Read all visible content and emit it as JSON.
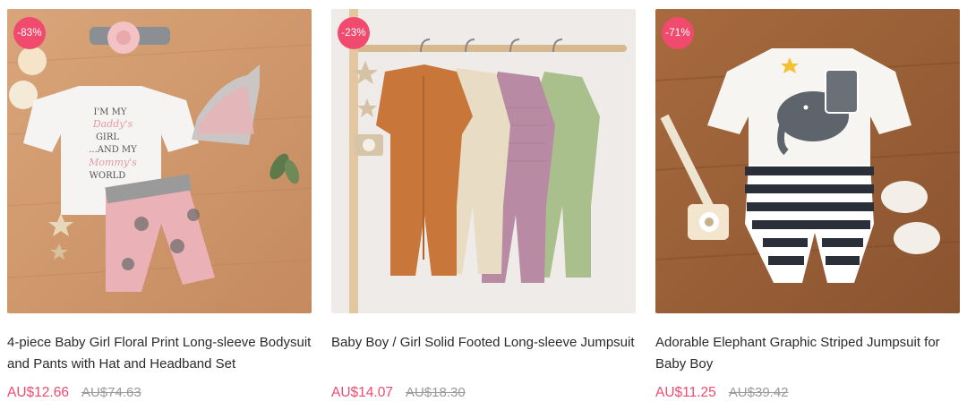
{
  "products": [
    {
      "discount": "-83%",
      "title": "4-piece Baby Girl Floral Print Long-sleeve Bodysuit and Pants with Hat and Headband Set",
      "price": "AU$12.66",
      "original_price": "AU$74.63",
      "image_text": [
        "I'M MY",
        "Daddy's",
        "GIRL",
        "...AND MY",
        "Mommy's",
        "WORLD"
      ]
    },
    {
      "discount": "-23%",
      "title": "Baby Boy / Girl Solid Footed Long-sleeve Jumpsuit",
      "price": "AU$14.07",
      "original_price": "AU$18.30"
    },
    {
      "discount": "-71%",
      "title": "Adorable Elephant Graphic Striped Jumpsuit for Baby Boy",
      "price": "AU$11.25",
      "original_price": "AU$39.42"
    }
  ],
  "colors": {
    "accent": "#f04b6f",
    "muted": "#9a9a9a",
    "text": "#2a2a2a"
  }
}
